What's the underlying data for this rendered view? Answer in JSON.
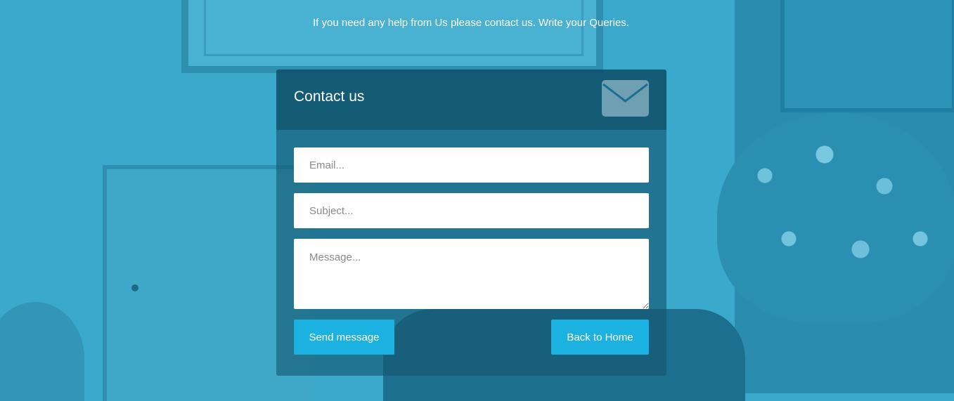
{
  "intro_text": "If you need any help from Us please contact us. Write your Queries.",
  "contact": {
    "title": "Contact us",
    "icon": "envelope-icon",
    "email_placeholder": "Email...",
    "subject_placeholder": "Subject...",
    "message_placeholder": "Message...",
    "send_label": "Send message",
    "home_label": "Back to Home"
  },
  "colors": {
    "background_tint": "#3aa9cc",
    "button": "#1bb1e0",
    "panel": "#14556e"
  }
}
